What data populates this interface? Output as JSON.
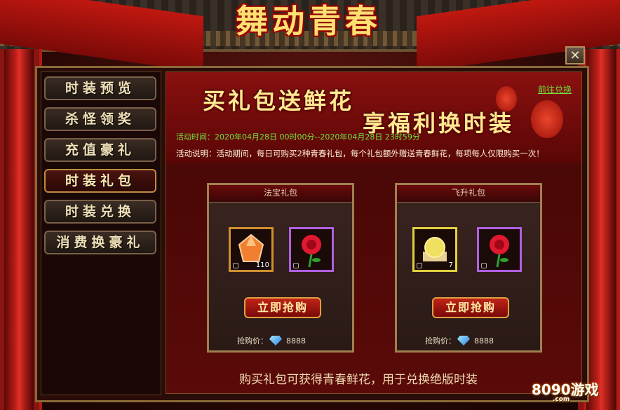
{
  "window": {
    "title": "舞动青春",
    "close_label": "✕"
  },
  "sidebar": {
    "items": [
      {
        "label": "时装预览"
      },
      {
        "label": "杀怪领奖"
      },
      {
        "label": "充值豪礼"
      },
      {
        "label": "时装礼包"
      },
      {
        "label": "时装兑换"
      },
      {
        "label": "消费换豪礼"
      }
    ],
    "active_index": 3
  },
  "banner": {
    "title_line1": "买礼包送鲜花",
    "title_line2": "享福利换时装",
    "goto_link": "前往兑换"
  },
  "activity": {
    "time_label": "活动时间：",
    "time_value": "2020年04月28日 00时00分--2020年04月28日 23时59分",
    "desc_label": "活动说明：",
    "desc_value": "活动期间，每日可购买2种青春礼包，每个礼包额外赠送青春鲜花，每项每人仅限购买一次！"
  },
  "packs": [
    {
      "name": "法宝礼包",
      "item1_icon": "crystal-icon",
      "item1_count": "110",
      "item2_icon": "rose-icon",
      "buy_label": "立即抢购",
      "price_label": "抢购价：",
      "price_value": "8888"
    },
    {
      "name": "飞升礼包",
      "item1_icon": "orb-icon",
      "item1_count": "7",
      "item2_icon": "rose-icon",
      "buy_label": "立即抢购",
      "price_label": "抢购价：",
      "price_value": "8888"
    }
  ],
  "footer_note": "购买礼包可获得青春鲜花，用于兑换绝版时装",
  "watermark": {
    "brand": "8090游戏",
    "domain": ".com"
  },
  "colors": {
    "accent_gold": "#ffe890",
    "link_green": "#70e040",
    "date_yellow": "#ffd060"
  }
}
